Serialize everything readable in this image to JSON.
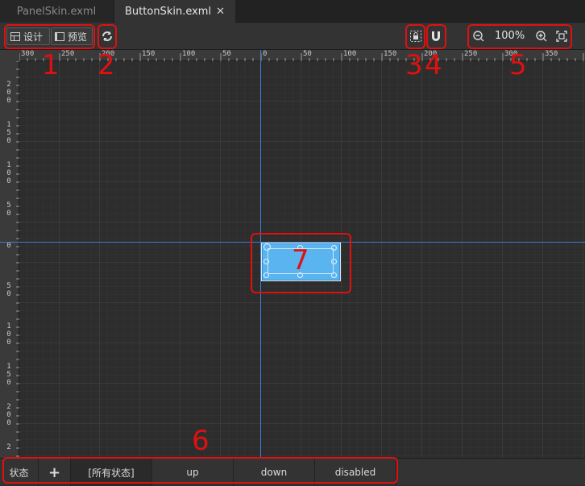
{
  "tabs": [
    {
      "label": "PanelSkin.exml",
      "active": false
    },
    {
      "label": "ButtonSkin.exml",
      "active": true,
      "close": "✕"
    }
  ],
  "toolbar": {
    "design_label": "设计",
    "preview_label": "预览",
    "refresh_icon": "refresh-icon",
    "lock_icon": "lock-frame-icon",
    "magnet_icon": "magnet-icon",
    "zoom_level": "100%",
    "zoom_out_icon": "zoom-out-icon",
    "zoom_in_icon": "zoom-in-icon",
    "fit_icon": "fit-screen-icon"
  },
  "ruler_h": [
    "300",
    "250",
    "200",
    "150",
    "100",
    "50",
    "0",
    "50",
    "100",
    "150",
    "200",
    "250",
    "300",
    "350"
  ],
  "ruler_v": [
    [
      "2",
      "0",
      "0"
    ],
    [
      "1",
      "5",
      "0"
    ],
    [
      "1",
      "0",
      "0"
    ],
    [
      "5",
      "0"
    ],
    [
      "0"
    ],
    [
      "5",
      "0"
    ],
    [
      "1",
      "0",
      "0"
    ],
    [
      "1",
      "5",
      "0"
    ],
    [
      "2",
      "0",
      "0"
    ],
    [
      "2"
    ]
  ],
  "states": {
    "label": "状态",
    "add": "+",
    "items": [
      "[所有状态]",
      "up",
      "down",
      "disabled"
    ],
    "selected": "[所有状态]"
  },
  "annotations": [
    "1",
    "2",
    "3",
    "4",
    "5",
    "6",
    "7"
  ],
  "colors": {
    "guide": "#3d7ed8",
    "button_fill": "#5ab4f0",
    "annotation": "#e01010"
  }
}
